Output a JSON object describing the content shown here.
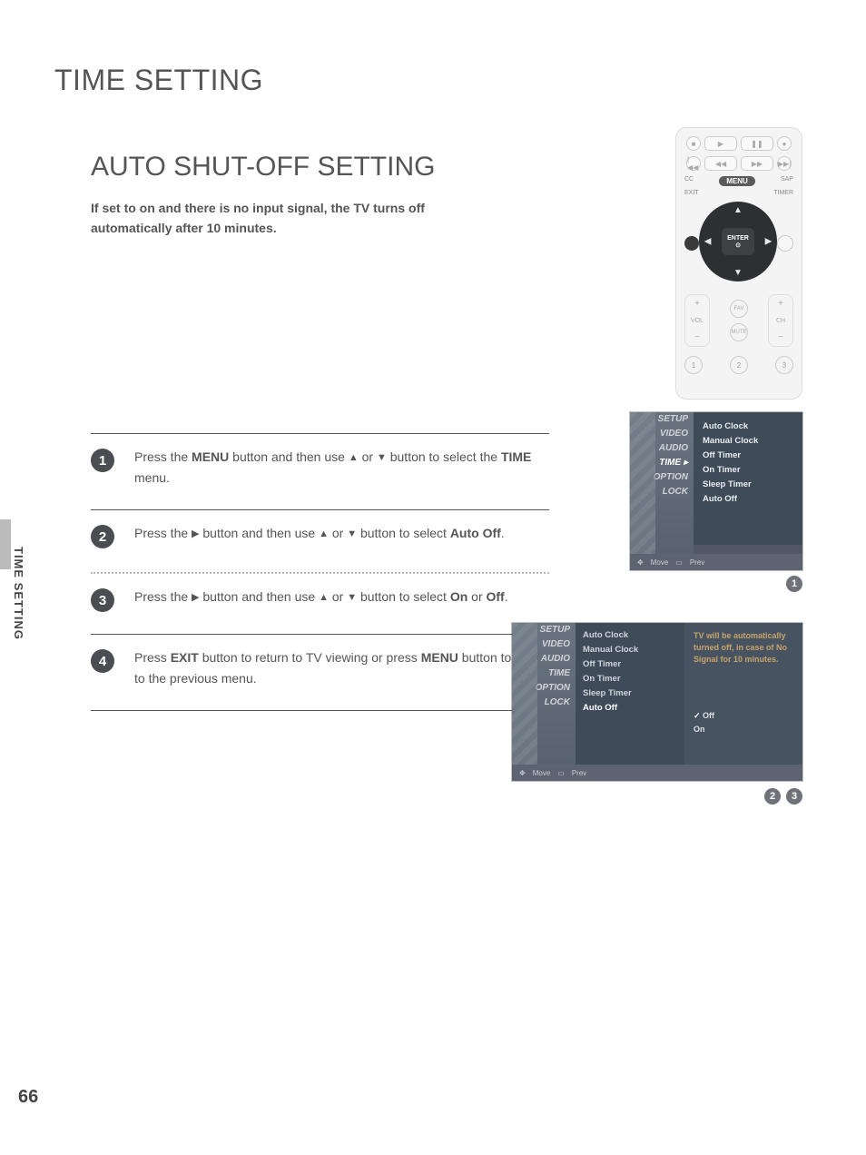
{
  "page": {
    "title": "TIME SETTING",
    "section": "AUTO SHUT-OFF SETTING",
    "intro": "If set to on and there is no input signal, the TV turns off automatically after 10 minutes.",
    "sideTab": "TIME SETTING",
    "number": "66"
  },
  "steps": {
    "s1": {
      "pre": "Press the ",
      "b1": "MENU",
      "mid1": " button and then use ",
      "mid2": " or ",
      "mid3": " button to select the ",
      "b2": "TIME",
      "post": " menu."
    },
    "s2": {
      "pre": "Press the ",
      "mid1": " button and then use ",
      "mid2": " or ",
      "mid3": " button to select ",
      "b1": "Auto Off",
      "post": "."
    },
    "s3": {
      "pre": "Press the ",
      "mid1": " button and then use ",
      "mid2": " or ",
      "mid3": " button to select ",
      "b1": "On",
      "or": " or ",
      "b2": "Off",
      "post": "."
    },
    "s4": {
      "pre": "Press ",
      "b1": "EXIT",
      "mid": " button to return to TV viewing or press ",
      "b2": "MENU",
      "post": " button to return to the previous menu."
    }
  },
  "remote": {
    "labels": {
      "cc": "CC",
      "sap": "SAP",
      "exit": "EXIT",
      "timer": "TIMER",
      "menu": "MENU",
      "enter": "ENTER",
      "vol": "VOL",
      "ch": "CH",
      "fav": "FAV",
      "mute": "MUTE"
    },
    "transport": {
      "stop": "■",
      "play": "▶",
      "pause": "❚❚",
      "rec": "●",
      "prevTrack": "|◀◀",
      "rew": "◀◀",
      "ff": "▶▶",
      "nextTrack": "▶▶|"
    },
    "nums": [
      "1",
      "2",
      "3"
    ]
  },
  "menu": {
    "tabs": [
      "SETUP",
      "VIDEO",
      "AUDIO",
      "TIME",
      "OPTION",
      "LOCK"
    ],
    "items": [
      "Auto Clock",
      "Manual Clock",
      "Off Timer",
      "On Timer",
      "Sleep Timer",
      "Auto Off"
    ],
    "footer": {
      "move": "Move",
      "prev": "Prev"
    },
    "detail": {
      "note": "TV will be automatically turned off, in case of No Signal for 10 minutes.",
      "options": [
        "Off",
        "On"
      ],
      "selected": "Off"
    }
  },
  "badges": {
    "b1": "1",
    "b2": "2",
    "b3": "3"
  }
}
